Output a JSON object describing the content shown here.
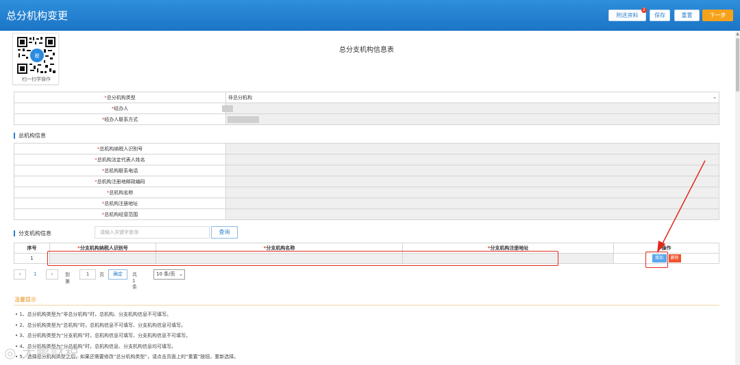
{
  "header": {
    "title": "总分机构变更",
    "buttons": {
      "attach": "附送资料",
      "attach_badge": "2",
      "save": "保存",
      "reset": "重置",
      "next": "下一步"
    }
  },
  "qr": {
    "caption": "扫一扫学操作"
  },
  "form": {
    "title": "总分支机构信息表",
    "type_label": "总分机构类型",
    "type_value": "非总分机构",
    "agent_label": "经办人",
    "agent_phone_label": "经办人联系方式"
  },
  "head_office": {
    "section_title": "总机构信息",
    "fields": [
      "总机构纳税人识别号",
      "总机构法定代表人姓名",
      "总机构联系电话",
      "总机构注册地邮政编码",
      "总机构名称",
      "总机构注册地址",
      "总机构经营范围"
    ]
  },
  "branch": {
    "section_title": "分支机构信息",
    "search_placeholder": "请输入关键字查询",
    "search_button": "查询",
    "columns": {
      "index": "序号",
      "taxid": "分支机构纳税人识别号",
      "name": "分支机构名称",
      "address": "分支机构注册地址",
      "ops": "操作"
    },
    "rows": [
      {
        "index": "1"
      }
    ],
    "add_button": "增加",
    "delete_button": "删除"
  },
  "pager": {
    "prev": "‹",
    "current": "1",
    "next": "›",
    "goto_prefix": "到第",
    "goto_value": "1",
    "goto_suffix": "页",
    "confirm": "确定",
    "total": "共 1 条",
    "page_size": "10 条/页"
  },
  "tips": {
    "title": "温馨提示",
    "items": [
      "• 1、总分机构类型为“非总分机构”时，总机构、分支机构信息不可填写。",
      "• 2、总分机构类型为“总机构”时，总机构信息不可填写、分支机构信息可填写。",
      "• 3、总分机构类型为“分支机构”时，总机构信息可填写、分支机构信息不可填写。",
      "• 4、总分机构类型为“分总机构”时，总机构信息、分支机构信息均可填写。",
      "• 5、选择总分机构类型之后，如果还需要修改“总分机构类型”，请点击页面上的“重置”按钮，重新选择。"
    ]
  },
  "watermark": "大鹏财税",
  "colors": {
    "header_blue": "#1f7fd2",
    "next_orange": "#f5a21a",
    "highlight_red": "#e0281c",
    "add_blue": "#5aa7ec",
    "delete_red": "#f0532e"
  }
}
